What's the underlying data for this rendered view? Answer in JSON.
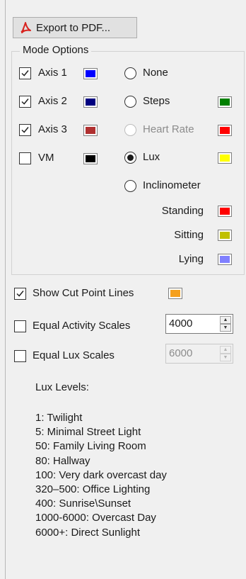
{
  "export_button": {
    "label": "Export to PDF..."
  },
  "mode_options": {
    "title": "Mode Options",
    "axes": [
      {
        "label": "Axis 1",
        "checked": true,
        "color": "#0000ff"
      },
      {
        "label": "Axis 2",
        "checked": true,
        "color": "#000080"
      },
      {
        "label": "Axis 3",
        "checked": true,
        "color": "#b03030"
      },
      {
        "label": "VM",
        "checked": false,
        "color": "#000000"
      }
    ],
    "modes": [
      {
        "label": "None",
        "selected": false,
        "enabled": true
      },
      {
        "label": "Steps",
        "selected": false,
        "enabled": true,
        "color": "#008000"
      },
      {
        "label": "Heart Rate",
        "selected": false,
        "enabled": false,
        "color": "#ff0000"
      },
      {
        "label": "Lux",
        "selected": true,
        "enabled": true,
        "color": "#ffff00"
      },
      {
        "label": "Inclinometer",
        "selected": false,
        "enabled": true
      }
    ],
    "inclinometer_states": [
      {
        "label": "Standing",
        "color": "#ff0000"
      },
      {
        "label": "Sitting",
        "color": "#c0c000"
      },
      {
        "label": "Lying",
        "color": "#8080ff"
      }
    ]
  },
  "show_cut_point_lines": {
    "label": "Show Cut Point Lines",
    "checked": true,
    "color": "#f5a01e"
  },
  "equal_activity_scales": {
    "label": "Equal Activity Scales",
    "checked": false,
    "value": "4000"
  },
  "equal_lux_scales": {
    "label": "Equal Lux Scales",
    "checked": false,
    "value": "6000",
    "enabled": false
  },
  "lux_levels": {
    "title": "Lux Levels:",
    "items": [
      "1: Twilight",
      "5: Minimal Street Light",
      "50: Family Living Room",
      "80: Hallway",
      "100: Very dark overcast day",
      "320–500: Office Lighting",
      "400: Sunrise\\Sunset",
      "1000-6000: Overcast Day",
      "6000+: Direct Sunlight"
    ]
  }
}
